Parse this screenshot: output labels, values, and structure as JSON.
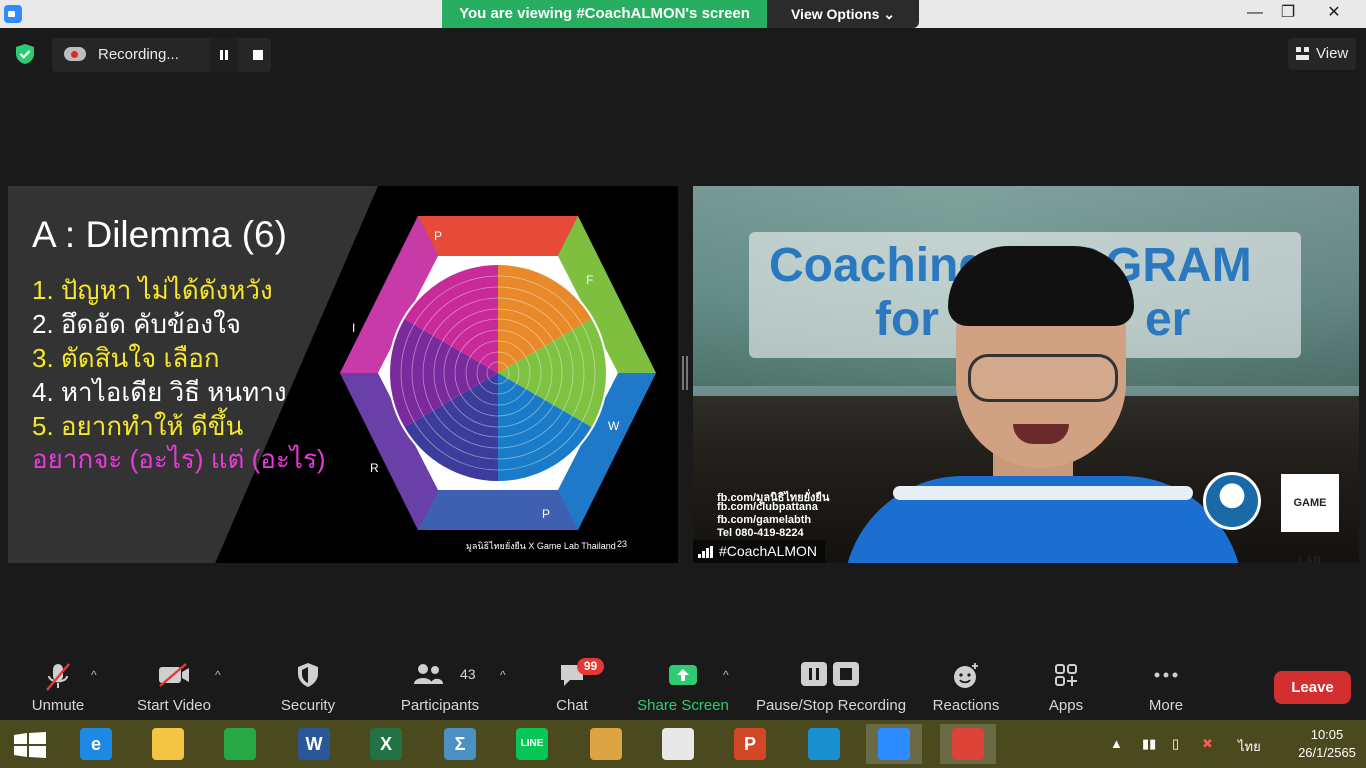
{
  "window": {
    "viewing_banner": "You are viewing #CoachALMON's screen",
    "view_options": "View Options",
    "controls": [
      "—",
      "❐",
      "✕"
    ]
  },
  "topbar": {
    "recording_label": "Recording...",
    "view_label": "View"
  },
  "slide": {
    "title": "A : Dilemma (6)",
    "lines": [
      {
        "text": "1.  ปัญหา ไม่ได้ดังหวัง",
        "color": "yellow"
      },
      {
        "text": "2. อึดอัด คับข้องใจ",
        "color": "white"
      },
      {
        "text": "3. ตัดสินใจ เลือก",
        "color": "yellow"
      },
      {
        "text": "4. หาไอเดีย วิธี หนทาง",
        "color": "white"
      },
      {
        "text": "5. อยากทำให้ ดีขึ้น",
        "color": "yellow"
      },
      {
        "text": "อยากจะ (อะไร) แต่ (อะไร)",
        "color": "magenta"
      }
    ],
    "footer": "มูลนิธิไทยยั่งยืน X Game Lab Thailand",
    "page_number": "23",
    "hex_labels": [
      "P",
      "F",
      "W",
      "P",
      "R",
      "I"
    ]
  },
  "video": {
    "title_line1": "Coaching PROGRAM",
    "title_line2": "for",
    "title_line2b": "er",
    "fb_lines": [
      "fb.com/มูลนิธิไทยยั่งยืน",
      "fb.com/clubpattana",
      "fb.com/gamelabth",
      "Tel 080-419-8224"
    ],
    "logo_game": "GAME LAB",
    "participant_name": "#CoachALMON"
  },
  "toolbar": {
    "unmute": "Unmute",
    "start_video": "Start Video",
    "security": "Security",
    "participants": "Participants",
    "participants_count": "43",
    "chat": "Chat",
    "chat_badge": "99",
    "share_screen": "Share Screen",
    "pause_stop_recording": "Pause/Stop Recording",
    "reactions": "Reactions",
    "apps": "Apps",
    "more": "More",
    "leave": "Leave"
  },
  "taskbar": {
    "apps": [
      {
        "name": "ie-icon",
        "glyph": "e",
        "color": "#1e88e5"
      },
      {
        "name": "file-explorer-icon",
        "glyph": "",
        "color": "#f4c542"
      },
      {
        "name": "store-icon",
        "glyph": "",
        "color": "#27a844"
      },
      {
        "name": "word-icon",
        "glyph": "W",
        "color": "#2b579a"
      },
      {
        "name": "excel-icon",
        "glyph": "X",
        "color": "#217346"
      },
      {
        "name": "math-icon",
        "glyph": "Σ",
        "color": "#4a90c2"
      },
      {
        "name": "line-icon",
        "glyph": "LINE",
        "color": "#06c755"
      },
      {
        "name": "paint-icon",
        "glyph": "",
        "color": "#d9a441"
      },
      {
        "name": "lisrel-icon",
        "glyph": "",
        "color": "#e8e8e8"
      },
      {
        "name": "powerpoint-icon",
        "glyph": "P",
        "color": "#d24726"
      },
      {
        "name": "edge-icon",
        "glyph": "",
        "color": "#1a8fd0"
      },
      {
        "name": "zoom-icon",
        "glyph": "",
        "color": "#2d8cff"
      },
      {
        "name": "chrome-icon",
        "glyph": "",
        "color": "#db4437"
      }
    ],
    "language": "ไทย",
    "time": "10:05",
    "date": "26/1/2565"
  },
  "colors": {
    "share_green": "#2ecc71",
    "leave_red": "#d32f2f",
    "banner_green": "#27ae60"
  }
}
